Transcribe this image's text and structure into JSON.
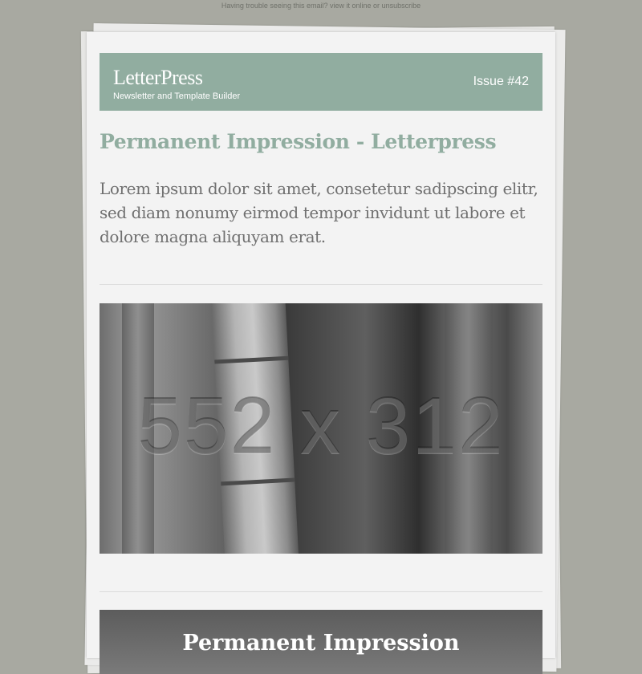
{
  "preheader": {
    "prefix": "Having trouble seeing this email?",
    "view_online": "view it online",
    "or": "or",
    "unsubscribe": "unsubscribe"
  },
  "header": {
    "brand": "LetterPress",
    "tagline": "Newsletter and Template Builder",
    "issue": "Issue #42",
    "color": "#91ada0"
  },
  "article": {
    "title": "Permanent Impression - Letterpress",
    "lead": "Lorem ipsum dolor sit amet, consetetur sadipscing elitr, sed diam nonumy eirmod tempor invidunt ut labore et dolore magna aliquyam erat.",
    "image_placeholder": "552 x 312"
  },
  "banner": {
    "title": "Permanent Impression"
  }
}
